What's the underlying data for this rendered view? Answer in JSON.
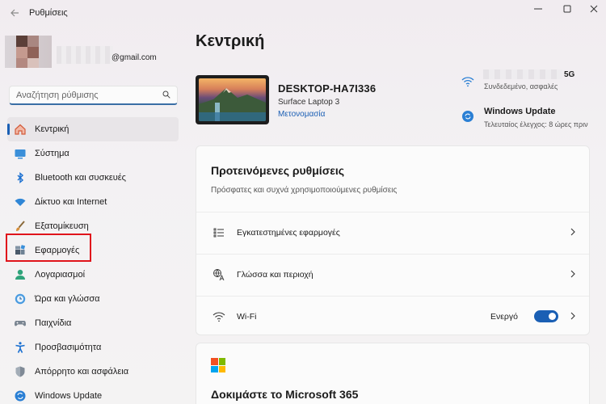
{
  "window": {
    "title": "Ρυθμίσεις",
    "back_icon": "back-arrow-icon",
    "controls": {
      "minimize": "—",
      "maximize": "☐",
      "close": "✕"
    }
  },
  "profile": {
    "email_suffix": "@gmail.com"
  },
  "search": {
    "placeholder": "Αναζήτηση ρύθμισης",
    "icon": "search-icon"
  },
  "sidebar": {
    "items": [
      {
        "label": "Κεντρική",
        "icon": "home-icon",
        "active": true
      },
      {
        "label": "Σύστημα",
        "icon": "system-monitor-icon"
      },
      {
        "label": "Bluetooth και συσκευές",
        "icon": "bluetooth-icon"
      },
      {
        "label": "Δίκτυο και Internet",
        "icon": "wifi-icon"
      },
      {
        "label": "Εξατομίκευση",
        "icon": "paintbrush-icon"
      },
      {
        "label": "Εφαρμογές",
        "icon": "apps-icon"
      },
      {
        "label": "Λογαριασμοί",
        "icon": "account-icon"
      },
      {
        "label": "Ώρα και γλώσσα",
        "icon": "clock-globe-icon"
      },
      {
        "label": "Παιχνίδια",
        "icon": "gamepad-icon"
      },
      {
        "label": "Προσβασιμότητα",
        "icon": "accessibility-icon"
      },
      {
        "label": "Απόρρητο και ασφάλεια",
        "icon": "shield-icon"
      },
      {
        "label": "Windows Update",
        "icon": "update-icon"
      }
    ]
  },
  "main": {
    "title": "Κεντρική",
    "device": {
      "name": "DESKTOP-HA7I336",
      "model": "Surface Laptop 3",
      "rename": "Μετονομασία"
    },
    "network": {
      "name_suffix": "5G",
      "status": "Συνδεδεμένο, ασφαλές"
    },
    "windows_update": {
      "title": "Windows Update",
      "subtitle": "Τελευταίος έλεγχος: 8 ώρες πριν"
    },
    "recommended": {
      "title": "Προτεινόμενες ρυθμίσεις",
      "subtitle": "Πρόσφατες και συχνά χρησιμοποιούμενες ρυθμίσεις",
      "rows": [
        {
          "label": "Εγκατεστημένες εφαρμογές",
          "icon": "list-icon"
        },
        {
          "label": "Γλώσσα και περιοχή",
          "icon": "language-icon"
        },
        {
          "label": "Wi-Fi",
          "icon": "wifi-icon",
          "toggle_label": "Ενεργό",
          "toggle_on": true
        }
      ]
    },
    "m365": {
      "title": "Δοκιμάστε το Microsoft 365"
    }
  },
  "colors": {
    "accent": "#1a5fb4",
    "highlight": "#e0141b"
  }
}
